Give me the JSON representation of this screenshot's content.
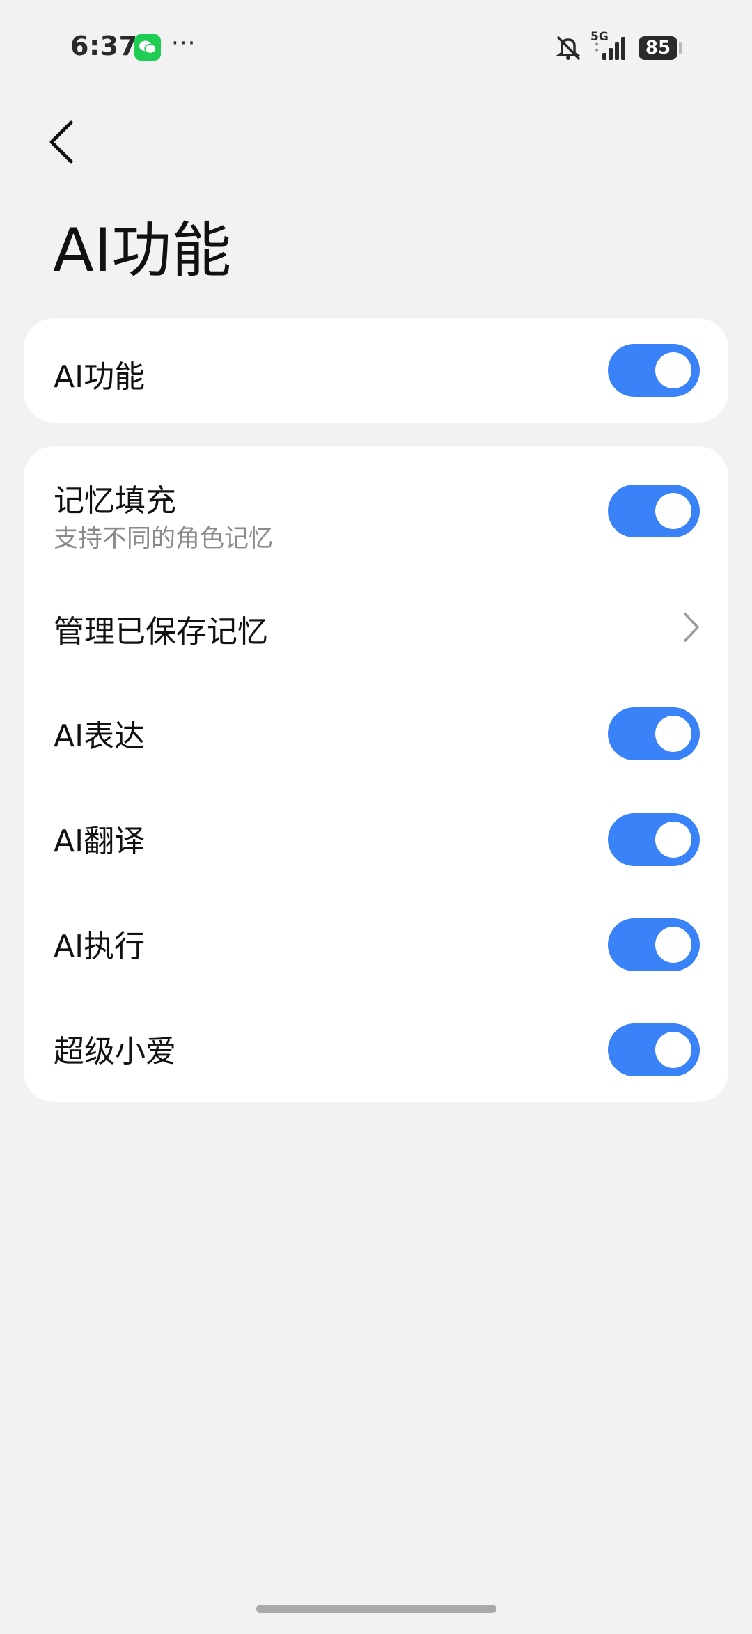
{
  "status_bar": {
    "time": "6:37",
    "network": "5G",
    "battery": "85",
    "more": "···",
    "icons": [
      "wechat-icon",
      "mute-icon",
      "signal-icon",
      "battery-icon"
    ]
  },
  "header": {
    "back_icon": "chevron-left-icon",
    "title": "AI功能"
  },
  "main_toggle": {
    "label": "AI功能",
    "enabled": true
  },
  "settings": {
    "memory_fill": {
      "label": "记忆填充",
      "subtitle": "支持不同的角色记忆",
      "enabled": true
    },
    "manage_memory": {
      "label": "管理已保存记忆",
      "icon": "chevron-right-icon"
    },
    "ai_expression": {
      "label": "AI表达",
      "enabled": true
    },
    "ai_translate": {
      "label": "AI翻译",
      "enabled": true
    },
    "ai_execute": {
      "label": "AI执行",
      "enabled": true
    },
    "super_xiaoai": {
      "label": "超级小爱",
      "enabled": true
    }
  },
  "colors": {
    "background": "#f2f2f2",
    "card": "#ffffff",
    "toggle_on": "#3a82f7",
    "subtitle": "#8a8a8a"
  }
}
